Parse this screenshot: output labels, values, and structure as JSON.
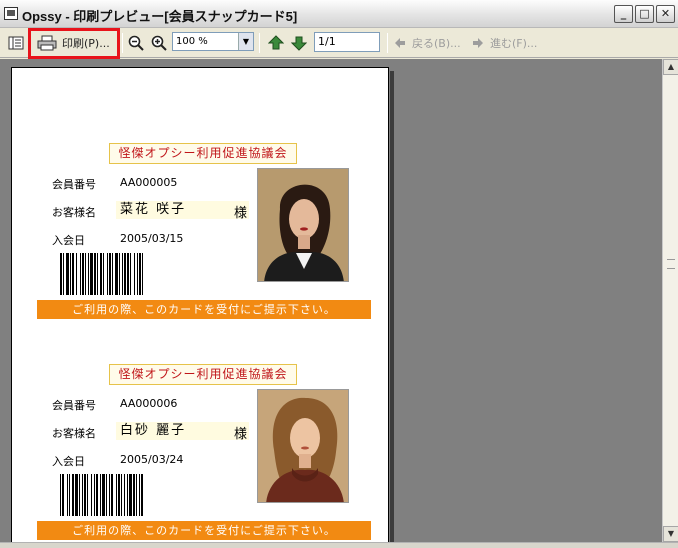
{
  "window": {
    "title": "Opssy - 印刷プレビュー[会員スナップカード5]",
    "controls": {
      "minimize": "_",
      "maximize": "□",
      "close": "✕"
    }
  },
  "toolbar": {
    "print_label": "印刷(P)...",
    "zoom_value": "100 %",
    "page_value": "1/1",
    "back_label": "戻る(B)...",
    "forward_label": "進む(F)..."
  },
  "icons": {
    "view": "view-icon",
    "printer": "printer-icon",
    "zoom_out": "zoom-out-icon",
    "zoom_in": "zoom-in-icon",
    "page_up": "page-up-icon",
    "page_down": "page-down-icon",
    "back": "back-arrow-icon",
    "forward": "forward-arrow-icon"
  },
  "colors": {
    "highlight": "#e8131b",
    "card_title": "#c0161a",
    "strip": "#f28a12",
    "title_border": "#e6c34a",
    "name_bg": "#fffbe0"
  },
  "cards": [
    {
      "title": "怪傑オプシー利用促進協議会",
      "member_no_label": "会員番号",
      "member_no": "AA000005",
      "customer_label": "お客様名",
      "customer_name": "菜花 咲子",
      "honorific": "様",
      "join_label": "入会日",
      "join_date": "2005/03/15",
      "notice": "ご利用の際、このカードを受付にご提示下さい。"
    },
    {
      "title": "怪傑オプシー利用促進協議会",
      "member_no_label": "会員番号",
      "member_no": "AA000006",
      "customer_label": "お客様名",
      "customer_name": "白砂 麗子",
      "honorific": "様",
      "join_label": "入会日",
      "join_date": "2005/03/24",
      "notice": "ご利用の際、このカードを受付にご提示下さい。"
    }
  ]
}
